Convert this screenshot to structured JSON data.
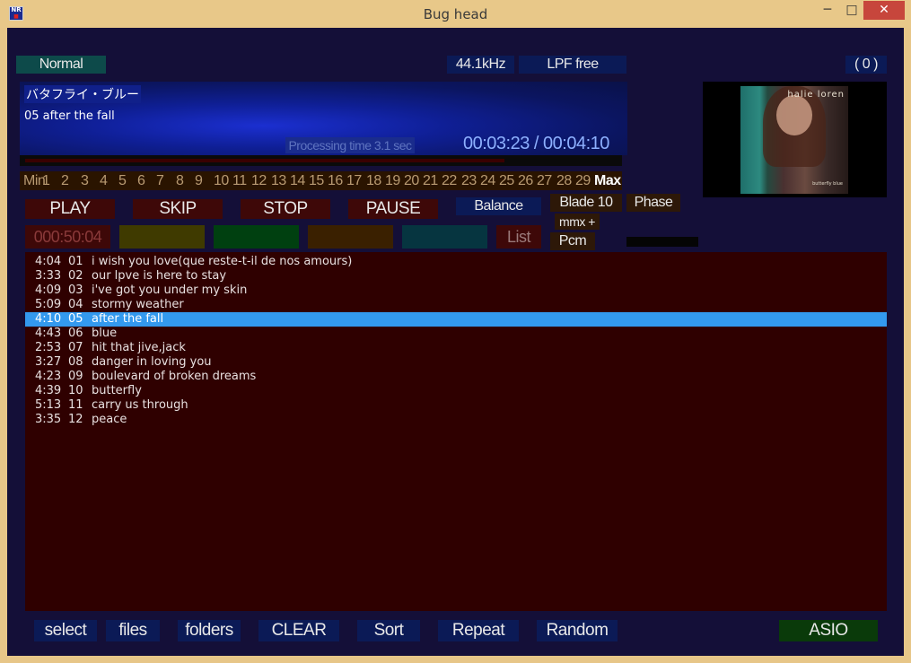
{
  "window": {
    "title": "Bug head",
    "icon_text_top": "NR",
    "icon_text_bottom": "■",
    "minimize": "─",
    "maximize": "□",
    "close": "✕"
  },
  "status": {
    "mode": "Normal",
    "sample_rate": "44.1kHz",
    "lpf": "LPF free",
    "count": "( 0 )"
  },
  "display": {
    "album_title": "バタフライ・ブルー",
    "current_track": "05  after the fall",
    "processing": "Processing time  3.1 sec",
    "time": "00:03:23 / 00:04:10",
    "progress": 0.81
  },
  "scale": {
    "min": "Min",
    "numbers": [
      "1",
      "2",
      "3",
      "4",
      "5",
      "6",
      "7",
      "8",
      "9",
      "10",
      "11",
      "12",
      "13",
      "14",
      "15",
      "16",
      "17",
      "18",
      "19",
      "20",
      "21",
      "22",
      "23",
      "24",
      "25",
      "26",
      "27",
      "28",
      "29"
    ],
    "max": "Max"
  },
  "controls": {
    "play": "PLAY",
    "skip": "SKIP",
    "stop": "STOP",
    "pause": "PAUSE",
    "balance": "Balance",
    "blade": "Blade 10",
    "phase": "Phase",
    "mmx": "mmx +",
    "pcm": "Pcm",
    "elapsed": "000:50:04",
    "list": "List"
  },
  "cover": {
    "artist": "halie loren",
    "subtitle": "butterfly blue"
  },
  "playlist": {
    "selected_index": 4,
    "rows": [
      {
        "dur": "4:04",
        "num": "01",
        "name": "i wish you love(que reste-t-il de nos amours)"
      },
      {
        "dur": "3:33",
        "num": "02",
        "name": "our lpve is here to stay"
      },
      {
        "dur": "4:09",
        "num": "03",
        "name": "i've got you under my skin"
      },
      {
        "dur": "5:09",
        "num": "04",
        "name": "stormy weather"
      },
      {
        "dur": "4:10",
        "num": "05",
        "name": "after the fall"
      },
      {
        "dur": "4:43",
        "num": "06",
        "name": "blue"
      },
      {
        "dur": "2:53",
        "num": "07",
        "name": "hit that jive,jack"
      },
      {
        "dur": "3:27",
        "num": "08",
        "name": "danger in loving you"
      },
      {
        "dur": "4:23",
        "num": "09",
        "name": "boulevard of broken dreams"
      },
      {
        "dur": "4:39",
        "num": "10",
        "name": "butterfly"
      },
      {
        "dur": "5:13",
        "num": "11",
        "name": "carry us through"
      },
      {
        "dur": "3:35",
        "num": "12",
        "name": "peace"
      }
    ]
  },
  "bottom": {
    "select": "select",
    "files": "files",
    "folders": "folders",
    "clear": "CLEAR",
    "sort": "Sort",
    "repeat": "Repeat",
    "random": "Random",
    "asio": "ASIO"
  },
  "colors": {
    "background": "#140f38",
    "playlist_bg": "#2f0000",
    "selection": "#3399ee",
    "button_red": "#3e0808",
    "button_blue": "#0b1a56"
  }
}
